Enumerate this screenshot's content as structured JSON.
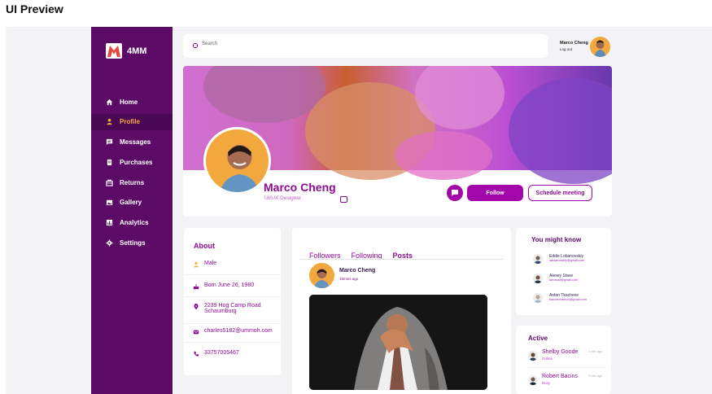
{
  "page": {
    "title": "UI Preview"
  },
  "brand": {
    "name": "4MM"
  },
  "sidebar": {
    "items": [
      {
        "label": "Home",
        "icon": "home-icon"
      },
      {
        "label": "Profile",
        "icon": "user-icon"
      },
      {
        "label": "Messages",
        "icon": "message-icon"
      },
      {
        "label": "Purchases",
        "icon": "document-icon"
      },
      {
        "label": "Returns",
        "icon": "return-icon"
      },
      {
        "label": "Gallery",
        "icon": "gallery-icon"
      },
      {
        "label": "Analytics",
        "icon": "analytics-icon"
      },
      {
        "label": "Settings",
        "icon": "gear-icon"
      }
    ]
  },
  "search": {
    "placeholder": "Search"
  },
  "user": {
    "name": "Marco Cheng",
    "logout": "Log out"
  },
  "profile": {
    "name": "Marco Cheng",
    "role": "UI/UX Designer",
    "follow": "Follow",
    "schedule": "Schedule meeting"
  },
  "about": {
    "title": "About",
    "gender": "Male",
    "born": "Born June 26, 1980",
    "address": "2239  Hog Camp Road Schaumburg",
    "email": "charles5182@ummoh.com",
    "phone": "33757005467"
  },
  "feed": {
    "tabs": [
      "Followers",
      "Following",
      "Posts"
    ],
    "post": {
      "name": "Marco Cheng",
      "time": "15mins ago"
    }
  },
  "know": {
    "title": "You might know",
    "people": [
      {
        "name": "Eddie Lobanovskiy",
        "email": "laboanovskiy@gmail.com"
      },
      {
        "name": "Alexey Stave",
        "email": "alexeyst@gmail.com"
      },
      {
        "name": "Anton Tkacheve",
        "email": "tkacheveanton@gmail.com"
      }
    ]
  },
  "active": {
    "title": "Active",
    "people": [
      {
        "name": "Shelby Goode",
        "status": "Online",
        "time": "1 min ago"
      },
      {
        "name": "Robert Bacins",
        "status": "Busy",
        "time": "9 min ago"
      }
    ]
  },
  "colors": {
    "primary": "#5b0a66",
    "accent": "#a306a9",
    "highlight": "#f5b13f"
  }
}
